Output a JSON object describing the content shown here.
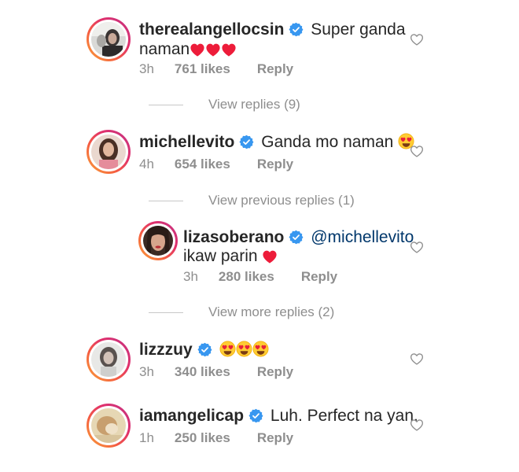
{
  "comments": [
    {
      "username": "therealangellocsin",
      "text_line1": "Super ganda",
      "text_line2": "naman",
      "time": "3h",
      "likes": "761 likes",
      "reply_label": "Reply"
    },
    {
      "username": "michellevito",
      "text": "Ganda mo naman",
      "time": "4h",
      "likes": "654 likes",
      "reply_label": "Reply"
    },
    {
      "username": "lizzzuy",
      "text": "",
      "time": "3h",
      "likes": "340 likes",
      "reply_label": "Reply"
    },
    {
      "username": "iamangelicap",
      "text": "Luh. Perfect na yan.",
      "time": "1h",
      "likes": "250 likes",
      "reply_label": "Reply"
    }
  ],
  "reply": {
    "username": "lizasoberano",
    "mention": "@michellevito",
    "text": "ikaw parin",
    "time": "3h",
    "likes": "280 likes",
    "reply_label": "Reply"
  },
  "links": {
    "view_replies": "View replies (9)",
    "view_previous": "View previous replies (1)",
    "view_more": "View more replies (2)"
  },
  "icons": {
    "verified": "verified-badge-icon",
    "like": "heart-outline-icon",
    "emoji_heart": "red-heart-emoji",
    "emoji_heart_eyes": "heart-eyes-emoji"
  },
  "colors": {
    "verified_blue": "#3897f0",
    "meta_gray": "#8e8e8e",
    "mention_blue": "#00376b",
    "heart_red": "#ed1c3a"
  }
}
